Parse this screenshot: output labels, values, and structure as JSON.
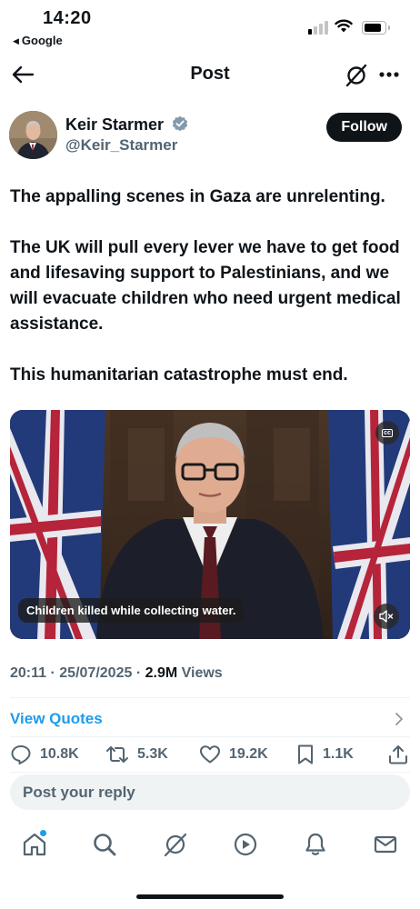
{
  "status_bar": {
    "time": "14:20",
    "back_app": "Google"
  },
  "nav": {
    "title": "Post"
  },
  "author": {
    "name": "Keir Starmer",
    "handle": "@Keir_Starmer",
    "follow_label": "Follow",
    "verified_color": "#829aab"
  },
  "tweet": {
    "paragraphs": [
      "The appalling scenes in Gaza are unrelenting.",
      "The UK will pull every lever we have to get food and lifesaving support to Palestinians, and we will evacuate children who need urgent medical assistance.",
      "This humanitarian catastrophe must end."
    ]
  },
  "media": {
    "caption": "Children killed while collecting water.",
    "cc_label": "cc"
  },
  "meta": {
    "time": "20:11",
    "date": "25/07/2025",
    "views_count": "2.9M",
    "views_label": "Views",
    "separator": "·"
  },
  "quotes": {
    "label": "View Quotes"
  },
  "actions": {
    "replies": "10.8K",
    "reposts": "5.3K",
    "likes": "19.2K",
    "bookmarks": "1.1K"
  },
  "reply": {
    "placeholder": "Post your reply"
  },
  "tabbar": {
    "items": [
      "home-icon",
      "search-icon",
      "grok-icon",
      "video-icon",
      "notifications-icon",
      "messages-icon"
    ]
  },
  "colors": {
    "accent": "#1d9bf0",
    "text": "#0f1419",
    "secondary": "#536471"
  }
}
